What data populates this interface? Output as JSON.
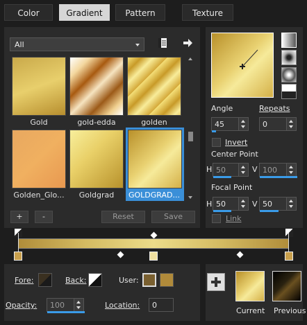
{
  "tabs": [
    {
      "label": "Color",
      "active": false
    },
    {
      "label": "Gradient",
      "active": true
    },
    {
      "label": "Pattern",
      "active": false
    },
    {
      "label": "Texture",
      "active": false
    }
  ],
  "filter": {
    "selected": "All"
  },
  "gradients": [
    {
      "label": "Gold"
    },
    {
      "label": "gold-edda"
    },
    {
      "label": "golden"
    },
    {
      "label": "Golden_Glo..."
    },
    {
      "label": "Goldgrad"
    },
    {
      "label": "GOLDGRAD...",
      "selected": true
    }
  ],
  "buttons": {
    "add": "+",
    "remove": "-",
    "reset": "Reset",
    "save": "Save"
  },
  "angle": {
    "label": "Angle",
    "value": "45",
    "level_percent": 12
  },
  "repeats": {
    "label": "Repeats",
    "value": "0"
  },
  "invert": {
    "label": "Invert",
    "checked": false
  },
  "center_point": {
    "label": "Center Point",
    "h_label": "H",
    "h": "50",
    "v_label": "V",
    "v": "100"
  },
  "focal_point": {
    "label": "Focal Point",
    "h_label": "H",
    "h": "50",
    "v_label": "V",
    "v": "50"
  },
  "link": {
    "label": "Link"
  },
  "colors": {
    "fore_label": "Fore:",
    "back_label": "Back:",
    "user_label": "User:",
    "fore": "#3a3020",
    "user1": "#7a6030",
    "user2": "#b08a3a",
    "accent": "#3a9be8"
  },
  "opacity": {
    "label": "Opacity:",
    "value": "100"
  },
  "location": {
    "label": "Location:",
    "value": "0"
  },
  "preview": {
    "current_label": "Current",
    "previous_label": "Previous"
  }
}
